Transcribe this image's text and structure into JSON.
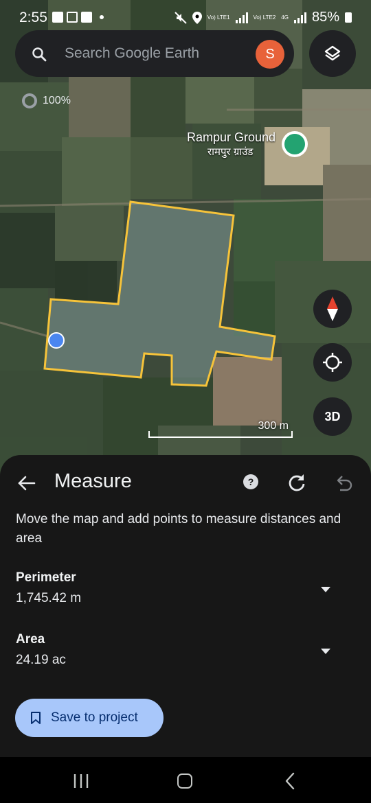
{
  "status_bar": {
    "time": "2:55",
    "sim1": "Vo) LTE1",
    "sim2": "Vo) LTE2",
    "network": "4G",
    "battery": "85%"
  },
  "search": {
    "placeholder": "Search Google Earth",
    "avatar_letter": "S"
  },
  "map": {
    "opacity_label": "100%",
    "place_name_en": "Rampur Ground",
    "place_name_hi": "रामपुर ग्राउंड",
    "scale_label": "300 m",
    "three_d_label": "3D",
    "polygon_color": "#f6c33a",
    "point_color": "#4a86f0"
  },
  "measure": {
    "title": "Measure",
    "help_label": "?",
    "description": "Move the map and add points to measure distances and area",
    "perimeter_label": "Perimeter",
    "perimeter_value": "1,745.42 m",
    "area_label": "Area",
    "area_value": "24.19 ac",
    "save_label": "Save to project"
  },
  "icons": {
    "search": "search-icon",
    "layers": "layers-icon",
    "compass": "compass-icon",
    "locate": "my-location-icon",
    "back": "arrow-back-icon",
    "help": "help-icon",
    "redo": "refresh-icon",
    "undo": "undo-icon",
    "bookmark": "bookmark-icon"
  },
  "colors": {
    "sheet_bg": "#171717",
    "save_bg": "#a8c7fa",
    "avatar_bg": "#e8623a"
  }
}
